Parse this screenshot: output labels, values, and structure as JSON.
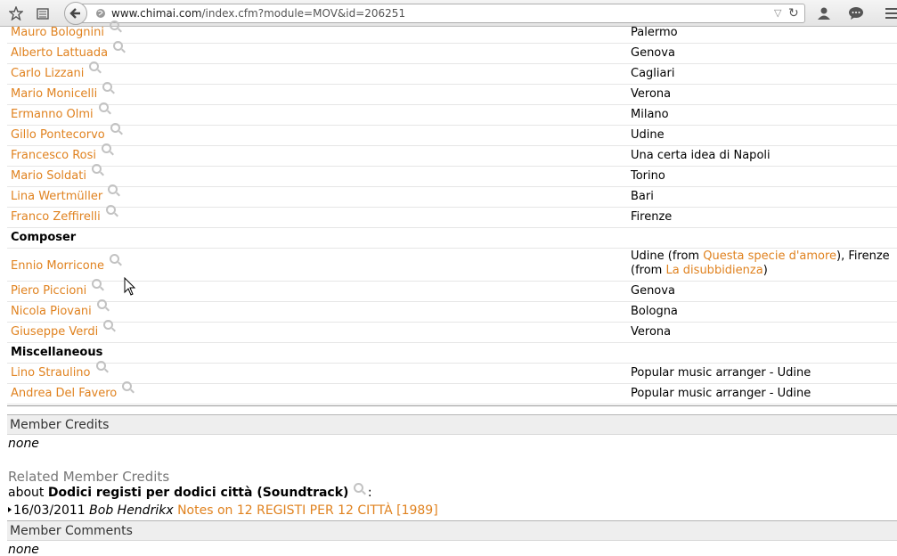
{
  "browser": {
    "url_domain": "www.chimai.com",
    "url_path": "/index.cfm?module=MOV&id=206251"
  },
  "credits": {
    "rows_a": [
      {
        "name": "Mauro Bolognini",
        "value": "Palermo"
      },
      {
        "name": "Alberto Lattuada",
        "value": "Genova"
      },
      {
        "name": "Carlo Lizzani",
        "value": "Cagliari"
      },
      {
        "name": "Mario Monicelli",
        "value": "Verona"
      },
      {
        "name": "Ermanno Olmi",
        "value": "Milano"
      },
      {
        "name": "Gillo Pontecorvo",
        "value": "Udine"
      },
      {
        "name": "Francesco Rosi",
        "value": "Una certa idea di Napoli"
      },
      {
        "name": "Mario Soldati",
        "value": "Torino"
      },
      {
        "name": "Lina Wertmüller",
        "value": "Bari"
      },
      {
        "name": "Franco Zeffirelli",
        "value": "Firenze"
      }
    ],
    "composer_title": "Composer",
    "morricone": {
      "name": "Ennio Morricone",
      "part1": "Udine (from ",
      "link1": "Questa specie d'amore",
      "part2": "), Firenze (from ",
      "link2": "La disubbidienza",
      "part3": ")"
    },
    "composer_rows": [
      {
        "name": "Piero Piccioni",
        "value": "Genova"
      },
      {
        "name": "Nicola Piovani",
        "value": "Bologna"
      },
      {
        "name": "Giuseppe Verdi",
        "value": "Verona"
      }
    ],
    "misc_title": "Miscellaneous",
    "misc_rows": [
      {
        "name": "Lino Straulino",
        "value": "Popular music arranger - Udine"
      },
      {
        "name": "Andrea Del Favero",
        "value": "Popular music arranger - Udine"
      }
    ]
  },
  "member_credits": {
    "title": "Member Credits",
    "value": "none"
  },
  "related": {
    "title": "Related Member Credits",
    "about_prefix": "about ",
    "about_title": "Dodici registi per dodici città (Soundtrack)",
    "about_suffix": " :",
    "note_date": "16/03/2011 ",
    "note_author": "Bob Hendrikx",
    "note_link": "Notes on 12 REGISTI PER 12 CITTÀ [1989]"
  },
  "member_comments": {
    "title": "Member Comments",
    "value": "none"
  }
}
